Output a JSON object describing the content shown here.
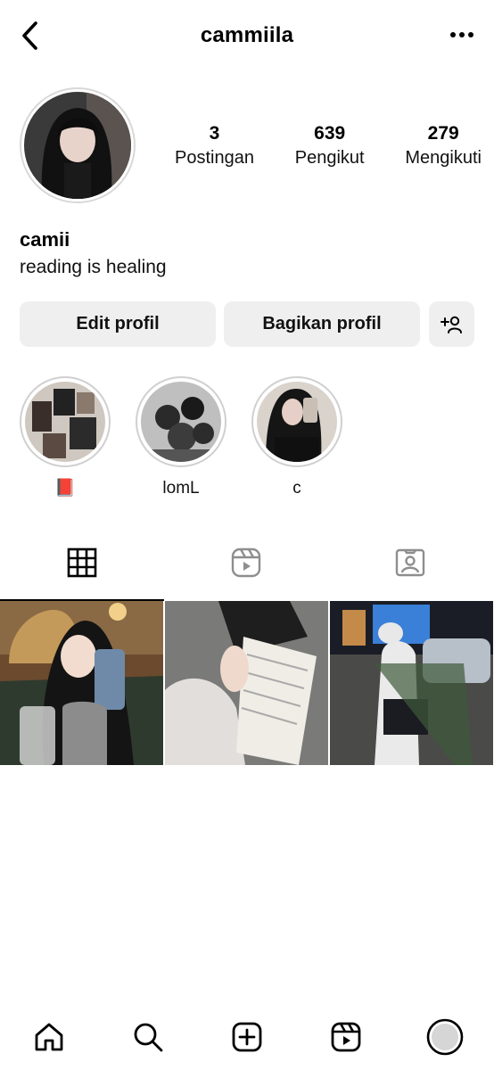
{
  "header": {
    "username": "cammiila",
    "back_icon": "chevron-left-icon",
    "more_icon": "more-horizontal-icon"
  },
  "profile": {
    "display_name": "camii",
    "bio": "reading is healing",
    "stats": [
      {
        "value": "3",
        "label": "Postingan"
      },
      {
        "value": "639",
        "label": "Pengikut"
      },
      {
        "value": "279",
        "label": "Mengikuti"
      }
    ]
  },
  "actions": {
    "edit_label": "Edit profil",
    "share_label": "Bagikan profil",
    "add_icon": "add-person-icon"
  },
  "highlights": [
    {
      "label": "📕"
    },
    {
      "label": "lomL"
    },
    {
      "label": "c"
    }
  ],
  "tabs": [
    {
      "icon": "grid-icon",
      "active": true
    },
    {
      "icon": "reels-icon",
      "active": false
    },
    {
      "icon": "tagged-icon",
      "active": false
    }
  ],
  "bottom_nav": [
    {
      "icon": "home-icon"
    },
    {
      "icon": "search-icon"
    },
    {
      "icon": "create-icon"
    },
    {
      "icon": "reels-icon"
    },
    {
      "icon": "profile-avatar-icon"
    }
  ],
  "colors": {
    "button_bg": "#efefef",
    "ring": "#d0d0d0",
    "text": "#000000"
  }
}
